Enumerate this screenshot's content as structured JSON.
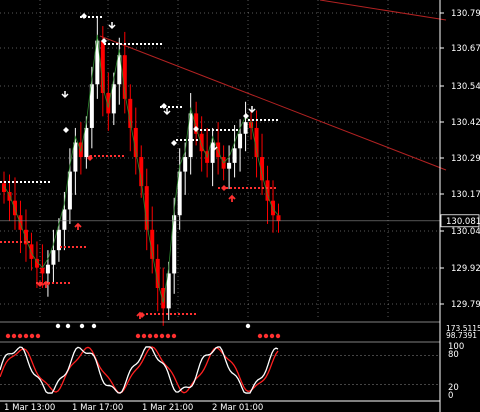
{
  "chart": {
    "price_axis_labels": [
      "130.795",
      "130.670",
      "130.545",
      "130.420",
      "130.295",
      "130.170",
      "130.045",
      "129.920",
      "129.795"
    ],
    "current_price": "130.081",
    "time_labels": [
      "1 Mar 13:00",
      "1 Mar 17:00",
      "1 Mar 21:00",
      "2 Mar 01:00"
    ],
    "strip_labels": [
      "173.5115",
      "98.7391"
    ],
    "oscillator_labels": [
      "100",
      "80",
      "20",
      "0"
    ],
    "colors": {
      "background": "#000000",
      "bull_candle": "#ffffff",
      "bear_candle": "#ff0000",
      "trendline": "#b22222",
      "signal_red": "#ff3030",
      "osc_main": "#ffffff",
      "osc_signal": "#ff2020"
    }
  },
  "chart_data": {
    "type": "candlestick",
    "symbol_hidden": true,
    "price_range": [
      129.73,
      130.85
    ],
    "candles_close_approx": [
      130.18,
      130.15,
      130.1,
      130.05,
      130.0,
      129.95,
      129.92,
      129.9,
      129.93,
      129.98,
      130.05,
      130.12,
      130.25,
      130.35,
      130.3,
      130.4,
      130.55,
      130.7,
      130.52,
      130.45,
      130.55,
      130.65,
      130.5,
      130.4,
      130.3,
      130.2,
      130.05,
      129.95,
      129.85,
      129.78,
      129.9,
      130.1,
      130.25,
      130.3,
      130.45,
      130.38,
      130.32,
      130.28,
      130.35,
      130.3,
      130.26,
      130.28,
      130.33,
      130.38,
      130.42,
      130.4,
      130.3,
      130.22,
      130.15,
      130.1,
      130.08
    ],
    "oscillator": {
      "range": [
        0,
        100
      ],
      "levels": [
        20,
        80
      ]
    }
  }
}
